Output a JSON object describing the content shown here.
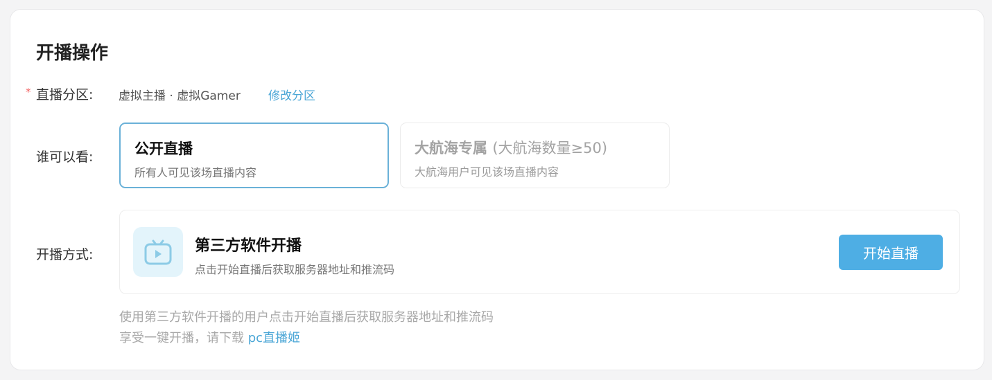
{
  "page_title": "开播操作",
  "zone": {
    "required_mark": "*",
    "label": "直播分区:",
    "value": "虚拟主播 · 虚拟Gamer",
    "edit_link": "修改分区"
  },
  "visibility": {
    "label": "谁可以看:",
    "options": [
      {
        "title": "公开直播",
        "note": "",
        "desc": "所有人可见该场直播内容",
        "selected": true
      },
      {
        "title": "大航海专属",
        "note": "(大航海数量≥50)",
        "desc": "大航海用户可见该场直播内容",
        "selected": false
      }
    ]
  },
  "method": {
    "label": "开播方式:",
    "icon": "tv-icon",
    "title": "第三方软件开播",
    "desc": "点击开始直播后获取服务器地址和推流码",
    "button_label": "开始直播"
  },
  "hint": {
    "line1": "使用第三方软件开播的用户点击开始直播后获取服务器地址和推流码",
    "line2_prefix": "享受一键开播，请下载",
    "line2_link": "pc直播姬"
  },
  "colors": {
    "accent": "#4eaee4",
    "link": "#4aa6d6",
    "selected_border": "#6ab1d8",
    "required": "#f25d5d"
  }
}
